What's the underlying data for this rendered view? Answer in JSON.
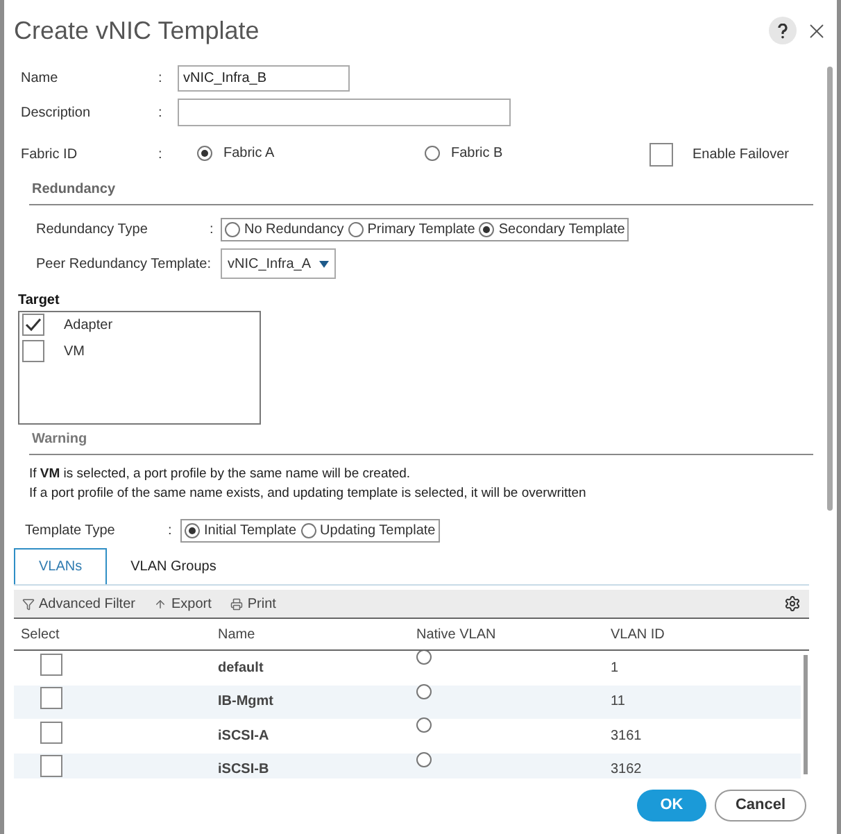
{
  "window": {
    "title": "Create vNIC Template"
  },
  "name_field": {
    "label": "Name",
    "separator": ":",
    "value": "vNIC_Infra_B"
  },
  "description_field": {
    "label": "Description",
    "separator": ":"
  },
  "fabric_id": {
    "label": "Fabric ID",
    "separator": ":",
    "options": [
      {
        "label": "Fabric A",
        "selected": true
      },
      {
        "label": "Fabric B",
        "selected": false
      }
    ]
  },
  "enable_failover": {
    "label": "Enable Failover",
    "checked": false
  },
  "redundancy": {
    "heading": "Redundancy",
    "type_label": "Redundancy Type",
    "type_separator": ":",
    "options": [
      {
        "label": "No Redundancy",
        "selected": false
      },
      {
        "label": "Primary Template",
        "selected": false
      },
      {
        "label": "Secondary Template",
        "selected": true
      }
    ],
    "peer_label": "Peer Redundancy Template:",
    "peer_value": "vNIC_Infra_A"
  },
  "target": {
    "label": "Target",
    "items": [
      {
        "label": "Adapter",
        "checked": true
      },
      {
        "label": "VM",
        "checked": false
      }
    ]
  },
  "warning": {
    "heading": "Warning",
    "lines": [
      "If **VM** is selected, a port profile by the same name will be created.",
      "If a port profile of the same name exists, and updating template is selected, it will be overwritten"
    ]
  },
  "template_type": {
    "label": "Template Type",
    "separator": ":",
    "options": [
      {
        "label": "Initial Template",
        "selected": true
      },
      {
        "label": "Updating Template",
        "selected": false
      }
    ]
  },
  "tabs": [
    {
      "label": "VLANs",
      "selected": true
    },
    {
      "label": "VLAN Groups",
      "selected": false
    }
  ],
  "toolbar": [
    {
      "kind": "filter",
      "label": "Advanced Filter"
    },
    {
      "kind": "export",
      "label": "Export"
    },
    {
      "kind": "print",
      "label": "Print"
    }
  ],
  "table": {
    "columns": [
      "Select",
      "Name",
      "Native VLAN",
      "VLAN ID"
    ],
    "rows": [
      {
        "checked": false,
        "name": "default",
        "native": false,
        "vlan_id": "1"
      },
      {
        "checked": false,
        "name": "IB-Mgmt",
        "native": false,
        "vlan_id": "11"
      },
      {
        "checked": false,
        "name": "iSCSI-A",
        "native": false,
        "vlan_id": "3161"
      },
      {
        "checked": false,
        "name": "iSCSI-B",
        "native": false,
        "vlan_id": "3162"
      }
    ]
  },
  "buttons": [
    {
      "kind": "primary",
      "label": "OK"
    },
    {
      "kind": "secondary",
      "label": "Cancel"
    }
  ]
}
